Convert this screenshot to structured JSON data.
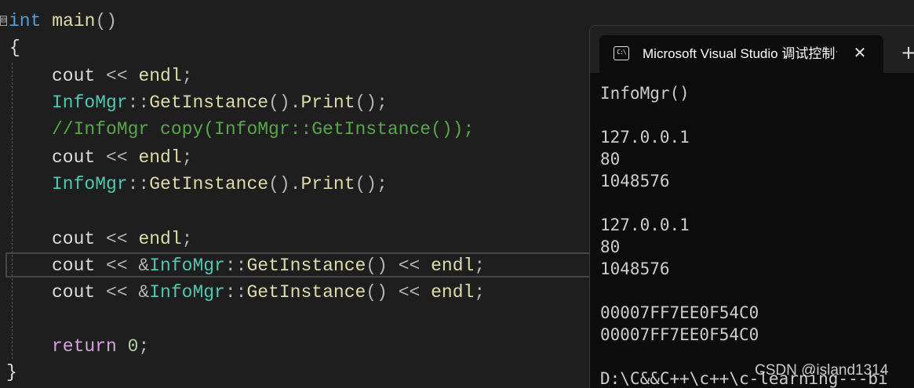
{
  "editor": {
    "fold_marker": "⊟",
    "lines": {
      "l1": {
        "kw": "int",
        "name": "main",
        "paren": "()"
      },
      "l2": {
        "text": "{"
      },
      "l3": {
        "a": "cout",
        "op": " << ",
        "b": "endl",
        "end": ";"
      },
      "l4": {
        "cls": "InfoMgr",
        "sep": "::",
        "fn1": "GetInstance",
        "mid": "().",
        "fn2": "Print",
        "end": "();"
      },
      "l5": {
        "comment": "//InfoMgr copy(InfoMgr::GetInstance());"
      },
      "l6": {
        "a": "cout",
        "op": " << ",
        "b": "endl",
        "end": ";"
      },
      "l7": {
        "cls": "InfoMgr",
        "sep": "::",
        "fn1": "GetInstance",
        "mid": "().",
        "fn2": "Print",
        "end": "();"
      },
      "l8": {
        "a": "cout",
        "op": " << ",
        "b": "endl",
        "end": ";"
      },
      "l9": {
        "a": "cout",
        "op": " << &",
        "cls": "InfoMgr",
        "sep": "::",
        "fn": "GetInstance",
        "paren": "()",
        "op2": " << ",
        "b": "endl",
        "end": ";"
      },
      "l10": {
        "a": "cout",
        "op": " << &",
        "cls": "InfoMgr",
        "sep": "::",
        "fn": "GetInstance",
        "paren": "()",
        "op2": " << ",
        "b": "endl",
        "end": ";"
      },
      "l11": {
        "kw": "return",
        "num": " 0",
        "end": ";"
      },
      "l12": {
        "text": "}"
      }
    }
  },
  "console": {
    "tab_title": "Microsoft Visual Studio 调试控制台",
    "tab_icon": "C:\\",
    "close_icon": "✕",
    "new_tab_icon": "+",
    "output": [
      "InfoMgr()",
      "127.0.0.1",
      "80",
      "1048576",
      "127.0.0.1",
      "80",
      "1048576",
      "00007FF7EE0F54C0",
      "00007FF7EE0F54C0",
      "D:\\C&&C++\\c++\\c-learning---bi"
    ]
  },
  "watermark": "CSDN @island1314"
}
